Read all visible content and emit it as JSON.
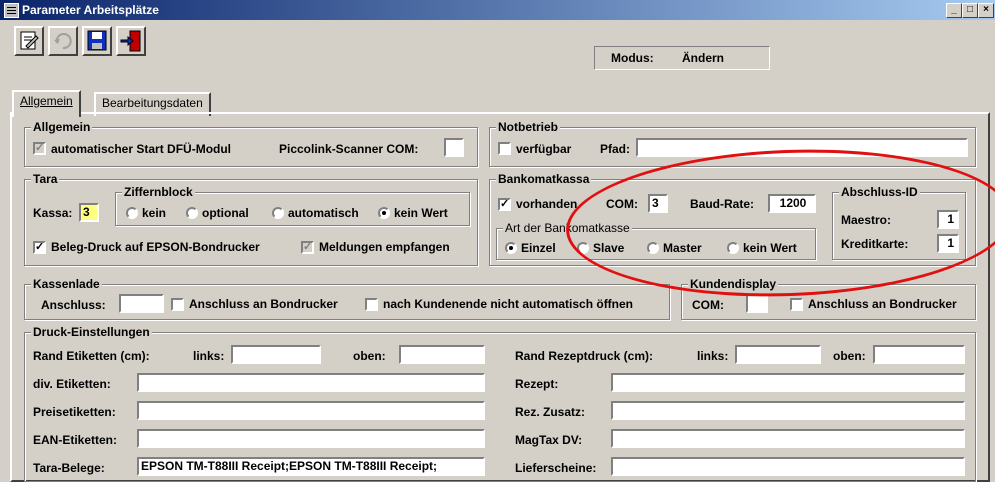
{
  "window": {
    "title": "Parameter Arbeitsplätze"
  },
  "toolbar": {
    "modus_label": "Modus:",
    "modus_value": "Ändern"
  },
  "tabs": [
    {
      "label": "Allgemein"
    },
    {
      "label": "Bearbeitungsdaten"
    }
  ],
  "allgemein": {
    "title": "Allgemein",
    "auto_start_label": "automatischer Start DFÜ-Modul",
    "piccolink_label": "Piccolink-Scanner COM:",
    "piccolink_value": ""
  },
  "notbetrieb": {
    "title": "Notbetrieb",
    "verfuegbar_label": "verfügbar",
    "pfad_label": "Pfad:",
    "pfad_value": ""
  },
  "tara": {
    "title": "Tara",
    "kassa_label": "Kassa:",
    "kassa_value": "3",
    "ziffernblock_title": "Ziffernblock",
    "options": [
      "kein",
      "optional",
      "automatisch",
      "kein Wert"
    ],
    "beleg_druck_label": "Beleg-Druck auf EPSON-Bondrucker",
    "meldungen_label": "Meldungen empfangen"
  },
  "bankomat": {
    "title": "Bankomatkassa",
    "vorhanden_label": "vorhanden",
    "com_label": "COM:",
    "com_value": "3",
    "baud_label": "Baud-Rate:",
    "baud_value": "1200",
    "art_title": "Art der Bankomatkasse",
    "art_options": [
      "Einzel",
      "Slave",
      "Master",
      "kein Wert"
    ],
    "abschluss_title": "Abschluss-ID",
    "maestro_label": "Maestro:",
    "maestro_value": "1",
    "kreditkarte_label": "Kreditkarte:",
    "kreditkarte_value": "1"
  },
  "kassenlade": {
    "title": "Kassenlade",
    "anschluss_label": "Anschluss:",
    "anschluss_value": "",
    "bondrucker_label": "Anschluss an Bondrucker",
    "nicht_oeffnen_label": "nach Kundenende nicht automatisch öffnen"
  },
  "kundendisplay": {
    "title": "Kundendisplay",
    "com_label": "COM:",
    "com_value": "",
    "bondrucker_label": "Anschluss an Bondrucker"
  },
  "druck": {
    "title": "Druck-Einstellungen",
    "rand_etiketten_label": "Rand Etiketten (cm):",
    "links_label": "links:",
    "oben_label": "oben:",
    "rand_rezept_label": "Rand Rezeptdruck (cm):",
    "div_etiketten_label": "div. Etiketten:",
    "preisetiketten_label": "Preisetiketten:",
    "ean_etiketten_label": "EAN-Etiketten:",
    "tara_belege_label": "Tara-Belege:",
    "tara_belege_value": "EPSON TM-T88III Receipt;EPSON TM-T88III Receipt;",
    "rezept_label": "Rezept:",
    "rez_zusatz_label": "Rez. Zusatz:",
    "magtax_label": "MagTax DV:",
    "lieferscheine_label": "Lieferscheine:"
  },
  "colors": {
    "highlight_input": "#ffff80",
    "annotation": "#e01010"
  }
}
